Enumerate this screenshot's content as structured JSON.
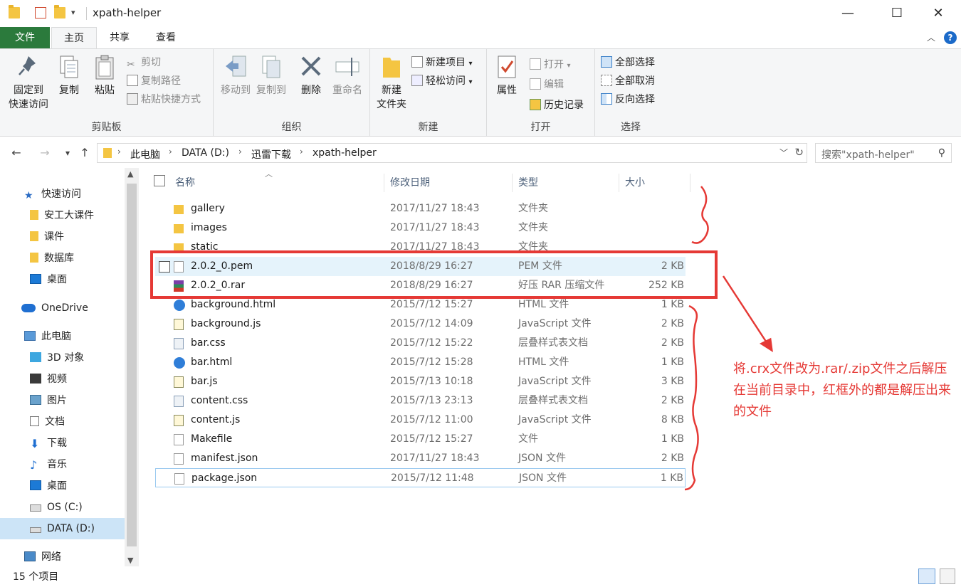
{
  "window": {
    "title": "xpath-helper",
    "minimize": "—",
    "maximize": "☐",
    "close": "✕"
  },
  "tabs": {
    "file": "文件",
    "home": "主页",
    "share": "共享",
    "view": "查看"
  },
  "ribbon": {
    "clipboard": {
      "label": "剪贴板",
      "pin_quick_access": "固定到\n快速访问",
      "copy": "复制",
      "paste": "粘贴",
      "cut": "剪切",
      "copy_path": "复制路径",
      "paste_shortcut": "粘贴快捷方式"
    },
    "organize": {
      "label": "组织",
      "move_to": "移动到",
      "copy_to": "复制到",
      "delete": "删除",
      "rename": "重命名"
    },
    "new": {
      "label": "新建",
      "new_folder": "新建\n文件夹",
      "new_item": "新建项目",
      "easy_access": "轻松访问"
    },
    "open": {
      "label": "打开",
      "properties": "属性",
      "open": "打开",
      "edit": "编辑",
      "history": "历史记录"
    },
    "select": {
      "label": "选择",
      "select_all": "全部选择",
      "select_none": "全部取消",
      "invert": "反向选择"
    }
  },
  "address": {
    "crumbs": [
      "此电脑",
      "DATA (D:)",
      "迅雷下载",
      "xpath-helper"
    ],
    "search_placeholder": "搜索\"xpath-helper\""
  },
  "nav": {
    "quick_access": "快速访问",
    "items_quick": [
      "安工大课件",
      "课件",
      "数据库",
      "桌面"
    ],
    "onedrive": "OneDrive",
    "this_pc": "此电脑",
    "items_pc": [
      "3D 对象",
      "视频",
      "图片",
      "文档",
      "下载",
      "音乐",
      "桌面",
      "OS (C:)",
      "DATA (D:)"
    ],
    "network": "网络"
  },
  "columns": {
    "name": "名称",
    "date": "修改日期",
    "type": "类型",
    "size": "大小"
  },
  "files": [
    {
      "name": "gallery",
      "date": "2017/11/27 18:43",
      "type": "文件夹",
      "size": "",
      "icon": "folder-icon"
    },
    {
      "name": "images",
      "date": "2017/11/27 18:43",
      "type": "文件夹",
      "size": "",
      "icon": "folder-icon"
    },
    {
      "name": "static",
      "date": "2017/11/27 18:43",
      "type": "文件夹",
      "size": "",
      "icon": "folder-icon"
    },
    {
      "name": "2.0.2_0.pem",
      "date": "2018/8/29 16:27",
      "type": "PEM 文件",
      "size": "2 KB",
      "icon": "file-icon"
    },
    {
      "name": "2.0.2_0.rar",
      "date": "2018/8/29 16:27",
      "type": "好压 RAR 压缩文件",
      "size": "252 KB",
      "icon": "rar-icon"
    },
    {
      "name": "background.html",
      "date": "2015/7/12 15:27",
      "type": "HTML 文件",
      "size": "1 KB",
      "icon": "html-icon"
    },
    {
      "name": "background.js",
      "date": "2015/7/12 14:09",
      "type": "JavaScript 文件",
      "size": "2 KB",
      "icon": "js-icon"
    },
    {
      "name": "bar.css",
      "date": "2015/7/12 15:22",
      "type": "层叠样式表文档",
      "size": "2 KB",
      "icon": "css-icon"
    },
    {
      "name": "bar.html",
      "date": "2015/7/12 15:28",
      "type": "HTML 文件",
      "size": "1 KB",
      "icon": "html-icon"
    },
    {
      "name": "bar.js",
      "date": "2015/7/13 10:18",
      "type": "JavaScript 文件",
      "size": "3 KB",
      "icon": "js-icon"
    },
    {
      "name": "content.css",
      "date": "2015/7/13 23:13",
      "type": "层叠样式表文档",
      "size": "2 KB",
      "icon": "css-icon"
    },
    {
      "name": "content.js",
      "date": "2015/7/12 11:00",
      "type": "JavaScript 文件",
      "size": "8 KB",
      "icon": "js-icon"
    },
    {
      "name": "Makefile",
      "date": "2015/7/12 15:27",
      "type": "文件",
      "size": "1 KB",
      "icon": "file-icon"
    },
    {
      "name": "manifest.json",
      "date": "2017/11/27 18:43",
      "type": "JSON 文件",
      "size": "2 KB",
      "icon": "file-icon"
    },
    {
      "name": "package.json",
      "date": "2015/7/12 11:48",
      "type": "JSON 文件",
      "size": "1 KB",
      "icon": "file-icon"
    }
  ],
  "status": {
    "item_count": "15 个项目"
  },
  "annotation": {
    "text": "将.crx文件改为.rar/.zip文件之后解压在当前目录中，红框外的都是解压出来的文件",
    "color": "#e53935"
  }
}
